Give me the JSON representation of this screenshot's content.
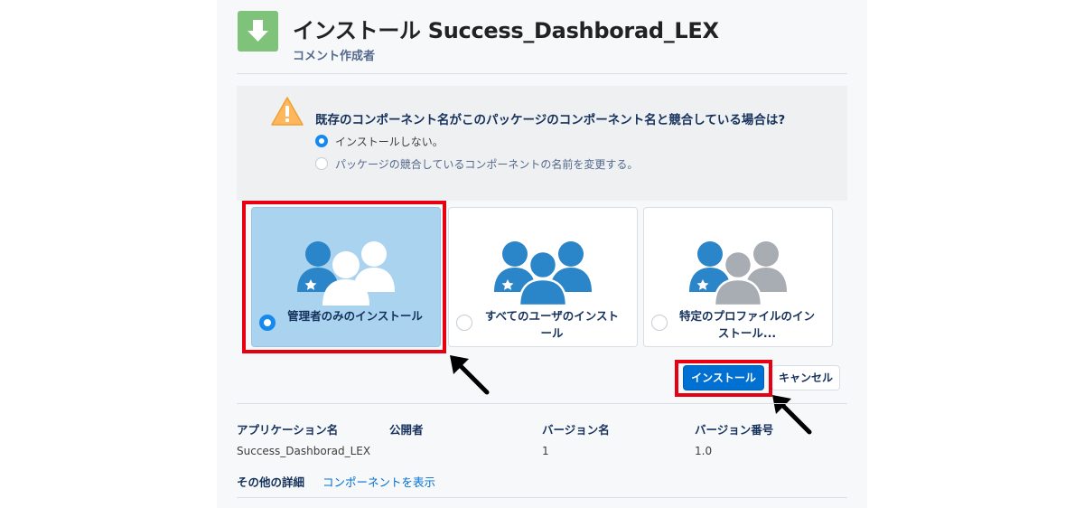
{
  "header": {
    "title": "インストール Success_Dashborad_LEX",
    "subtitle": "コメント作成者",
    "icon": "download-arrow-icon"
  },
  "conflict": {
    "question": "既存のコンポーネント名がこのパッケージのコンポーネント名と競合している場合は?",
    "options": [
      {
        "label": "インストールしない。",
        "selected": true
      },
      {
        "label": "パッケージの競合しているコンポーネントの名前を変更する。",
        "selected": false
      }
    ]
  },
  "install_for": {
    "options": [
      {
        "label": "管理者のみのインストール",
        "selected": true
      },
      {
        "label": "すべてのユーザのインストール",
        "selected": false
      },
      {
        "label": "特定のプロファイルのインストール...",
        "selected": false
      }
    ]
  },
  "buttons": {
    "install": "インストール",
    "cancel": "キャンセル"
  },
  "details": {
    "columns": [
      "アプリケーション名",
      "公開者",
      "バージョン名",
      "バージョン番号"
    ],
    "values": [
      "Success_Dashborad_LEX",
      "",
      "1",
      "1.0"
    ],
    "more_label": "その他の詳細",
    "more_link": "コンポーネントを表示"
  },
  "colors": {
    "accent": "#0070d2",
    "selected_card": "#a9d3ee",
    "highlight": "#e60012",
    "icon_bg": "#7fc37b"
  }
}
